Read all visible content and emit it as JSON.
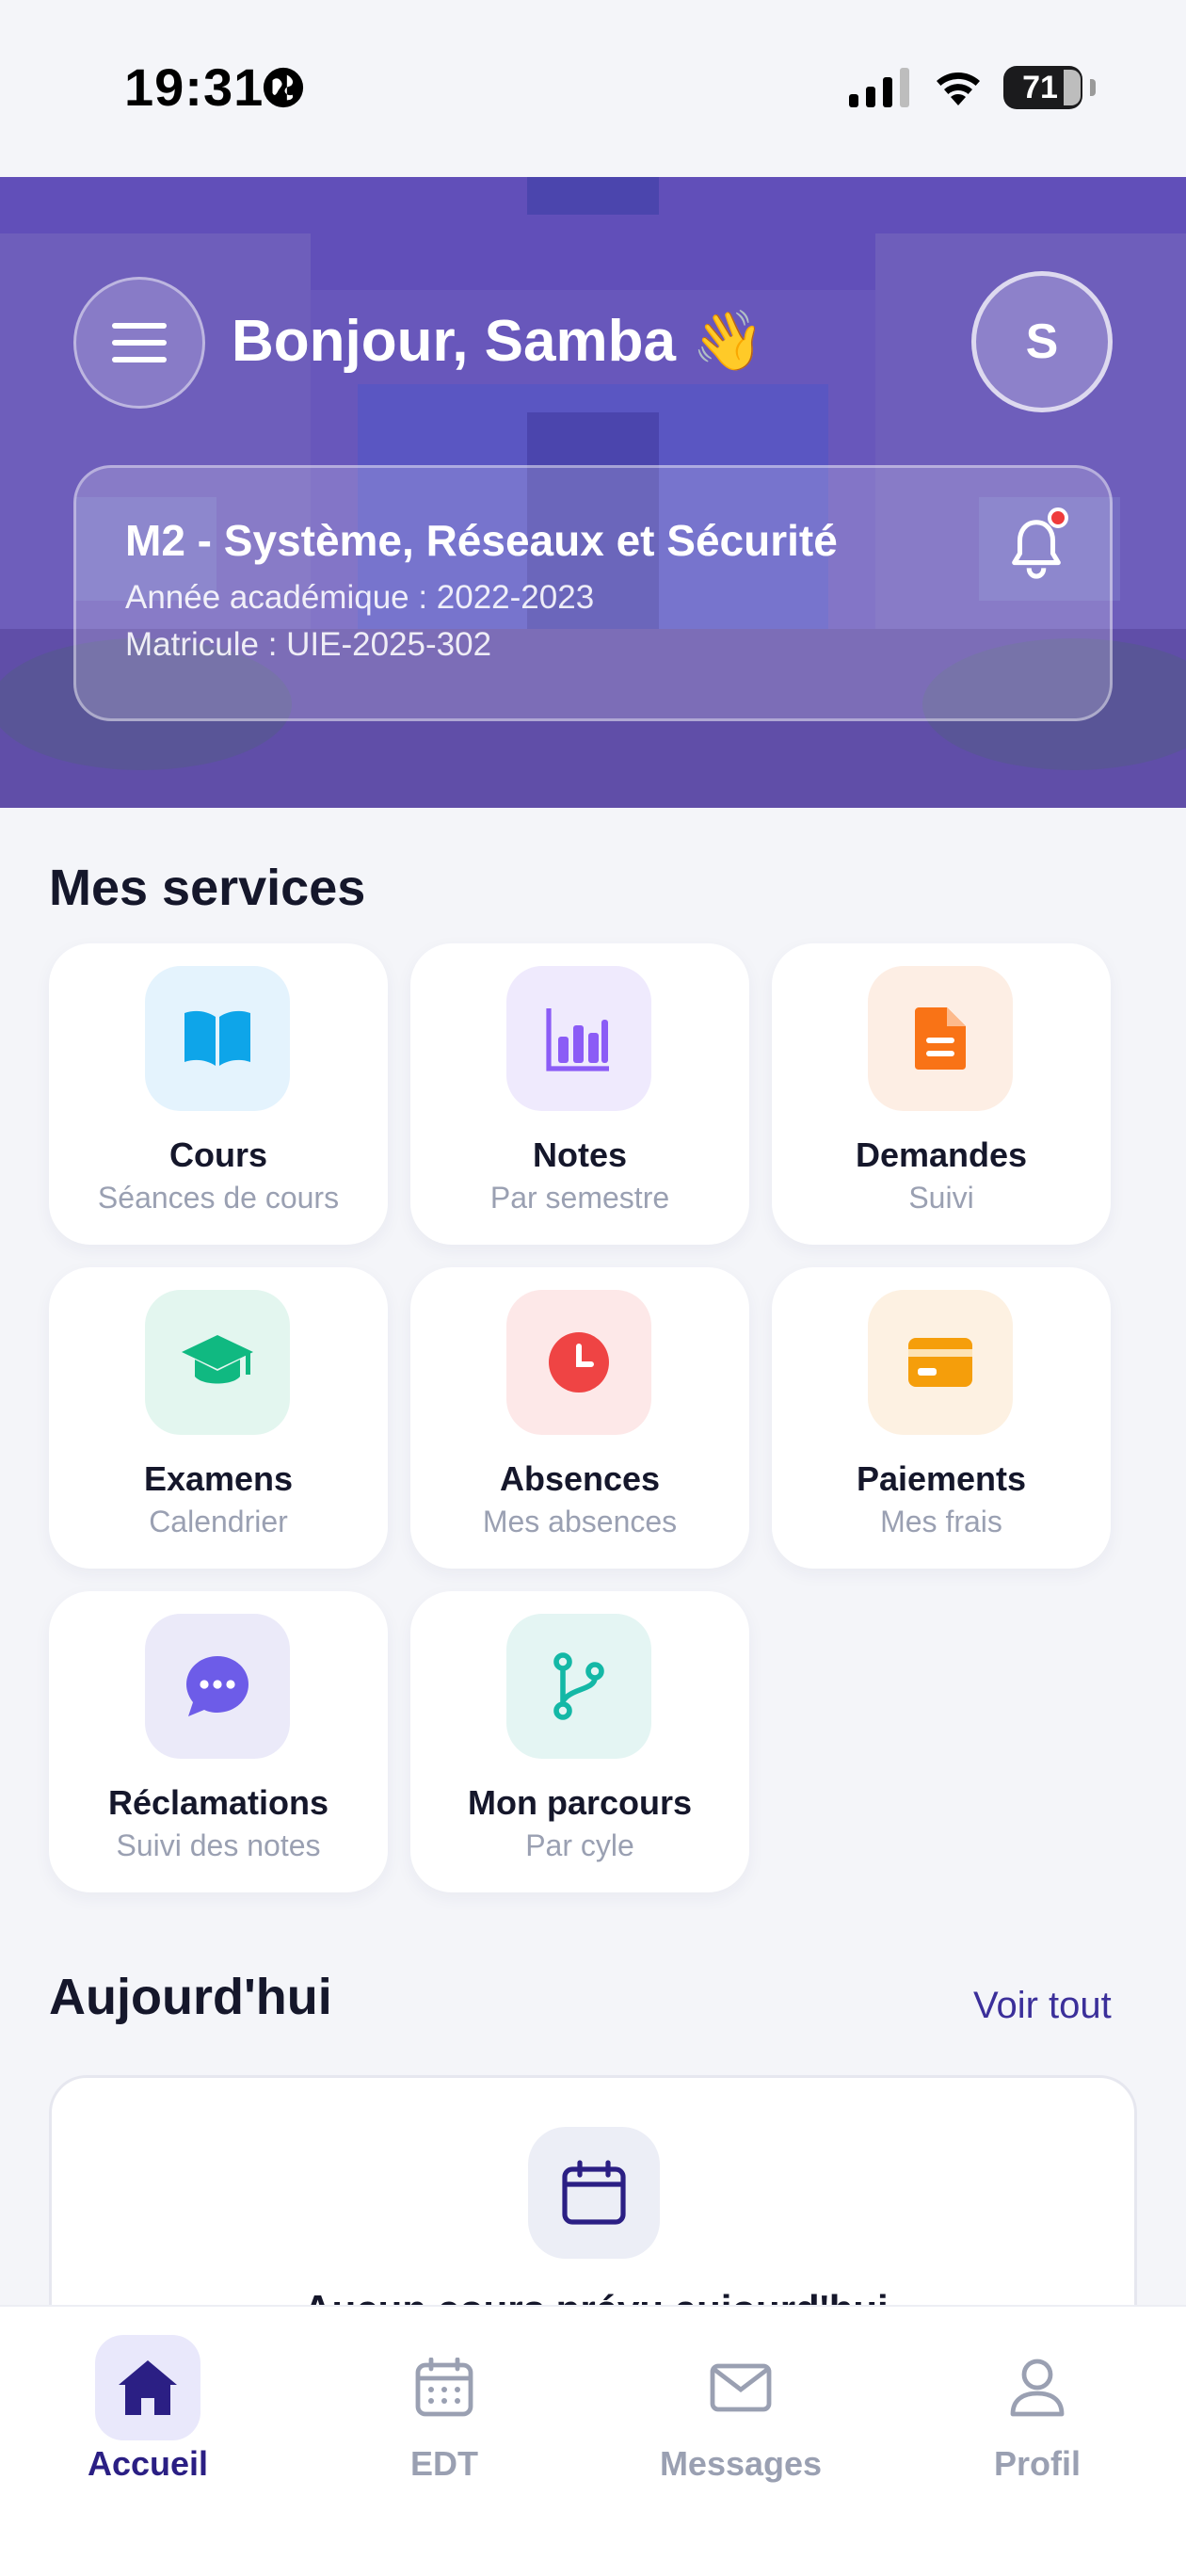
{
  "status_bar": {
    "time": "19:31",
    "battery": "71"
  },
  "header": {
    "greeting": "Bonjour, Samba 👋",
    "avatar_initial": "S",
    "program": {
      "title": "M2 - Système, Réseaux et Sécurité",
      "year": "Année académique : 2022-2023",
      "matricule": "Matricule : UIE-2025-302"
    }
  },
  "services": {
    "title": "Mes services",
    "items": [
      {
        "title": "Cours",
        "subtitle": "Séances de cours",
        "icon": "book-icon",
        "color": "#0ea5e9",
        "bg": "#e4f3fd"
      },
      {
        "title": "Notes",
        "subtitle": "Par semestre",
        "icon": "bar-chart-icon",
        "color": "#8b5cf6",
        "bg": "#efeafd"
      },
      {
        "title": "Demandes",
        "subtitle": "Suivi",
        "icon": "document-icon",
        "color": "#f97316",
        "bg": "#fdeee4"
      },
      {
        "title": "Examens",
        "subtitle": "Calendrier",
        "icon": "graduation-cap-icon",
        "color": "#10b981",
        "bg": "#e3f6ef"
      },
      {
        "title": "Absences",
        "subtitle": "Mes absences",
        "icon": "clock-icon",
        "color": "#ef4444",
        "bg": "#fde8e8"
      },
      {
        "title": "Paiements",
        "subtitle": "Mes frais",
        "icon": "credit-card-icon",
        "color": "#f59e0b",
        "bg": "#fdf1e2"
      },
      {
        "title": "Réclamations",
        "subtitle": "Suivi des notes",
        "icon": "chat-bubble-icon",
        "color": "#6d5ce8",
        "bg": "#ebeaf9"
      },
      {
        "title": "Mon parcours",
        "subtitle": "Par cyle",
        "icon": "branch-icon",
        "color": "#14b8a6",
        "bg": "#e4f5f3"
      }
    ]
  },
  "today": {
    "title": "Aujourd'hui",
    "see_all": "Voir tout",
    "empty_text": "Aucun cours prévu aujourd'hui"
  },
  "tabbar": {
    "tabs": [
      {
        "label": "Accueil",
        "icon": "home-icon",
        "active": true
      },
      {
        "label": "EDT",
        "icon": "calendar-icon",
        "active": false
      },
      {
        "label": "Messages",
        "icon": "mail-icon",
        "active": false
      },
      {
        "label": "Profil",
        "icon": "user-icon",
        "active": false
      }
    ]
  },
  "colors": {
    "accent": "#2b1f84",
    "hero": "#5a48b1",
    "muted": "#9aa0b2"
  }
}
